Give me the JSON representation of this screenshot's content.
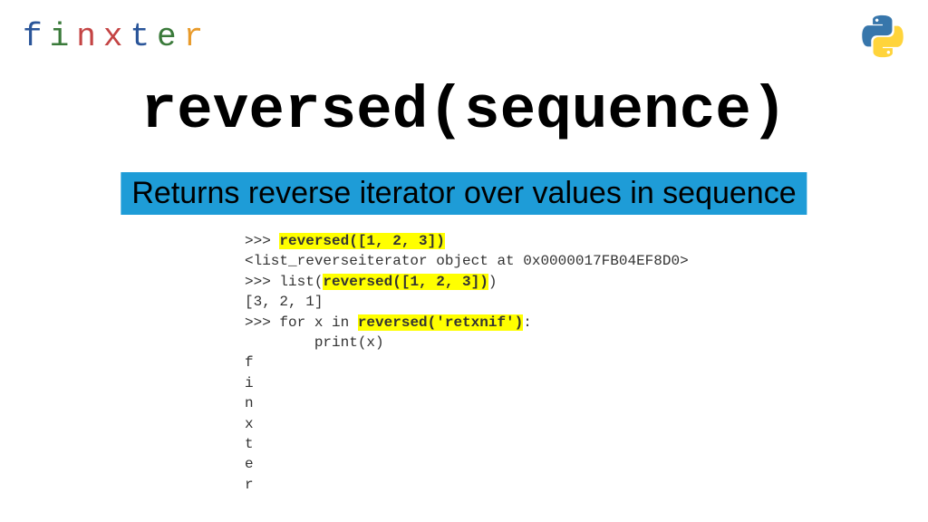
{
  "logo": {
    "letters": [
      "f",
      "i",
      "n",
      "x",
      "t",
      "e",
      "r"
    ],
    "colors": [
      "#2a5599",
      "#3a7a3a",
      "#c44444",
      "#c44444",
      "#2a5599",
      "#3a7a3a",
      "#e89a2a"
    ]
  },
  "title": "reversed(sequence)",
  "description": "Returns reverse iterator over values in sequence",
  "code": {
    "line1_prompt": ">>> ",
    "line1_hl": "reversed([1, 2, 3])",
    "line2": "<list_reverseiterator object at 0x0000017FB04EF8D0>",
    "line3_prompt": ">>> list(",
    "line3_hl": "reversed([1, 2, 3])",
    "line3_end": ")",
    "line4": "[3, 2, 1]",
    "line5_prompt": ">>> for x in ",
    "line5_hl": "reversed('retxnif')",
    "line5_end": ":",
    "line6": "        print(x)",
    "out1": "f",
    "out2": "i",
    "out3": "n",
    "out4": "x",
    "out5": "t",
    "out6": "e",
    "out7": "r"
  }
}
